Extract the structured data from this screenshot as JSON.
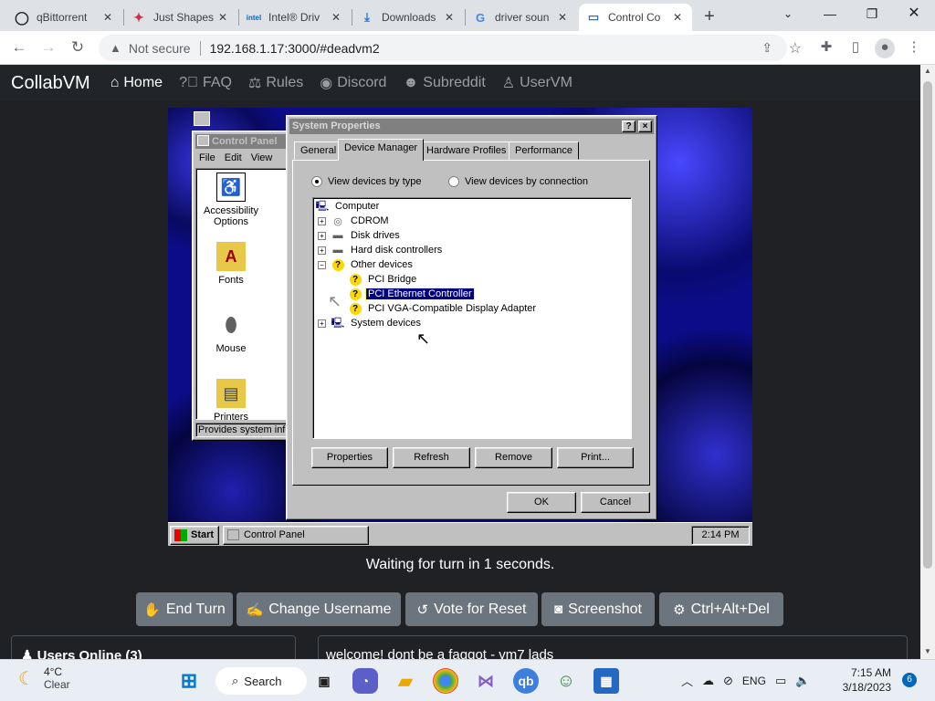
{
  "browser": {
    "tabs": [
      {
        "title": "qBittorrent",
        "icon": "qbittorrent-icon"
      },
      {
        "title": "Just Shapes",
        "icon": "just-shapes-icon"
      },
      {
        "title": "Intel® Driv",
        "icon": "intel-icon"
      },
      {
        "title": "Downloads",
        "icon": "download-icon"
      },
      {
        "title": "driver soun",
        "icon": "google-icon"
      },
      {
        "title": "Control Co",
        "icon": "monitor-icon",
        "active": true
      }
    ],
    "url": "192.168.1.17:3000/#deadvm2",
    "security_label": "Not secure",
    "accent": "#1a73e8"
  },
  "nav": {
    "brand": "CollabVM",
    "links": [
      "Home",
      "FAQ",
      "Rules",
      "Discord",
      "Subreddit",
      "UserVM"
    ]
  },
  "vm": {
    "control_panel": {
      "title": "Control Panel",
      "menus": [
        "File",
        "Edit",
        "View"
      ],
      "items": [
        {
          "label": "Accessibility Options"
        },
        {
          "label": "Fonts"
        },
        {
          "label": "Mouse"
        },
        {
          "label": "Printers"
        }
      ],
      "status": "Provides system info"
    },
    "dialog": {
      "title": "System Properties",
      "tabs": [
        "General",
        "Device Manager",
        "Hardware Profiles",
        "Performance"
      ],
      "radio_by_type": "View devices by type",
      "radio_by_connection": "View devices by connection",
      "tree": {
        "root": "Computer",
        "items": [
          {
            "label": "CDROM"
          },
          {
            "label": "Disk drives"
          },
          {
            "label": "Hard disk controllers"
          },
          {
            "label": "Other devices"
          },
          {
            "label": "PCI Bridge"
          },
          {
            "label": "PCI Ethernet Controller",
            "selected": true
          },
          {
            "label": "PCI VGA-Compatible Display Adapter"
          },
          {
            "label": "System devices"
          }
        ]
      },
      "buttons": {
        "properties": "Properties",
        "refresh": "Refresh",
        "remove": "Remove",
        "print": "Print...",
        "ok": "OK",
        "cancel": "Cancel"
      },
      "help_glyph": "?",
      "close_glyph": "×"
    },
    "taskbar": {
      "start": "Start",
      "task": "Control Panel",
      "clock": "2:14 PM"
    }
  },
  "turn_status": "Waiting for turn in 1 seconds.",
  "actions": [
    "End Turn",
    "Change Username",
    "Vote for Reset",
    "Screenshot",
    "Ctrl+Alt+Del"
  ],
  "users_online": "Users Online (3)",
  "chat_message": "welcome! dont be a faggot - vm7 lads",
  "windows": {
    "weather_temp": "4°C",
    "weather_cond": "Clear",
    "search": "Search",
    "lang": "ENG",
    "time": "7:15 AM",
    "date": "3/18/2023",
    "notifications": "6"
  }
}
